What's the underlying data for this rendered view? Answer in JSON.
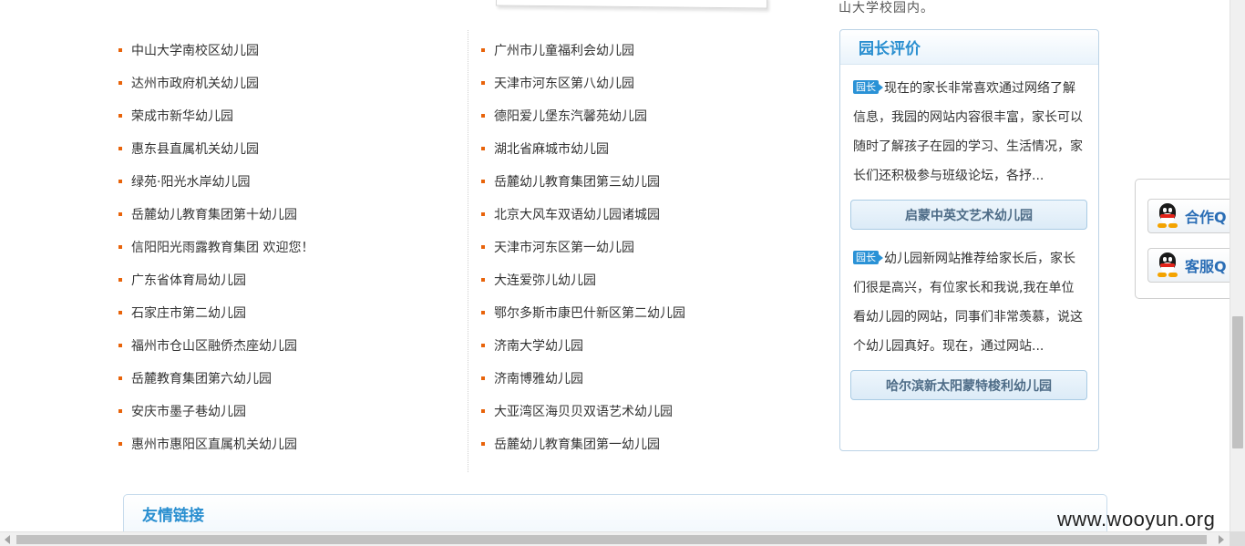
{
  "top": {
    "partial_text": "山大学校园内。"
  },
  "kindergartens": {
    "left": [
      "中山大学南校区幼儿园",
      "达州市政府机关幼儿园",
      "荣成市新华幼儿园",
      "惠东县直属机关幼儿园",
      "绿苑·阳光水岸幼儿园",
      "岳麓幼儿教育集团第十幼儿园",
      "信阳阳光雨露教育集团 欢迎您！",
      "广东省体育局幼儿园",
      "石家庄市第二幼儿园",
      "福州市仓山区融侨杰座幼儿园",
      "岳麓教育集团第六幼儿园",
      "安庆市墨子巷幼儿园",
      "惠州市惠阳区直属机关幼儿园"
    ],
    "right": [
      "广州市儿童福利会幼儿园",
      "天津市河东区第八幼儿园",
      "德阳爱儿堡东汽馨苑幼儿园",
      "湖北省麻城市幼儿园",
      "岳麓幼儿教育集团第三幼儿园",
      "北京大风车双语幼儿园诸城园",
      "天津市河东区第一幼儿园",
      "大连爱弥儿幼儿园",
      "鄂尔多斯市康巴什新区第二幼儿园",
      "济南大学幼儿园",
      "济南博雅幼儿园",
      "大亚湾区海贝贝双语艺术幼儿园",
      "岳麓幼儿教育集团第一幼儿园"
    ]
  },
  "reviews": {
    "title": "园长评价",
    "items": [
      {
        "tag": "园长",
        "text": "现在的家长非常喜欢通过网络了解信息，我园的网站内容很丰富，家长可以随时了解孩子在园的学习、生活情况，家长们还积极参与班级论坛，各抒...",
        "school": "启蒙中英文艺术幼儿园"
      },
      {
        "tag": "园长",
        "text": "幼儿园新网站推荐给家长后，家长们很是高兴，有位家长和我说,我在单位看幼儿园的网站，同事们非常羡慕，说这个幼儿园真好。现在，通过网站...",
        "school": "哈尔滨新太阳蒙特梭利幼儿园"
      }
    ]
  },
  "qq_panel": {
    "buttons": [
      {
        "label": "合作Q",
        "icon": "qq-penguin-icon"
      },
      {
        "label": "客服Q",
        "icon": "qq-penguin-icon"
      }
    ]
  },
  "friend_links": {
    "title": "友情链接"
  },
  "watermark": "www.wooyun.org",
  "colors": {
    "accent_blue": "#2a8fd0",
    "bullet_orange": "#e8630a",
    "tag_blue": "#2a92d6"
  }
}
